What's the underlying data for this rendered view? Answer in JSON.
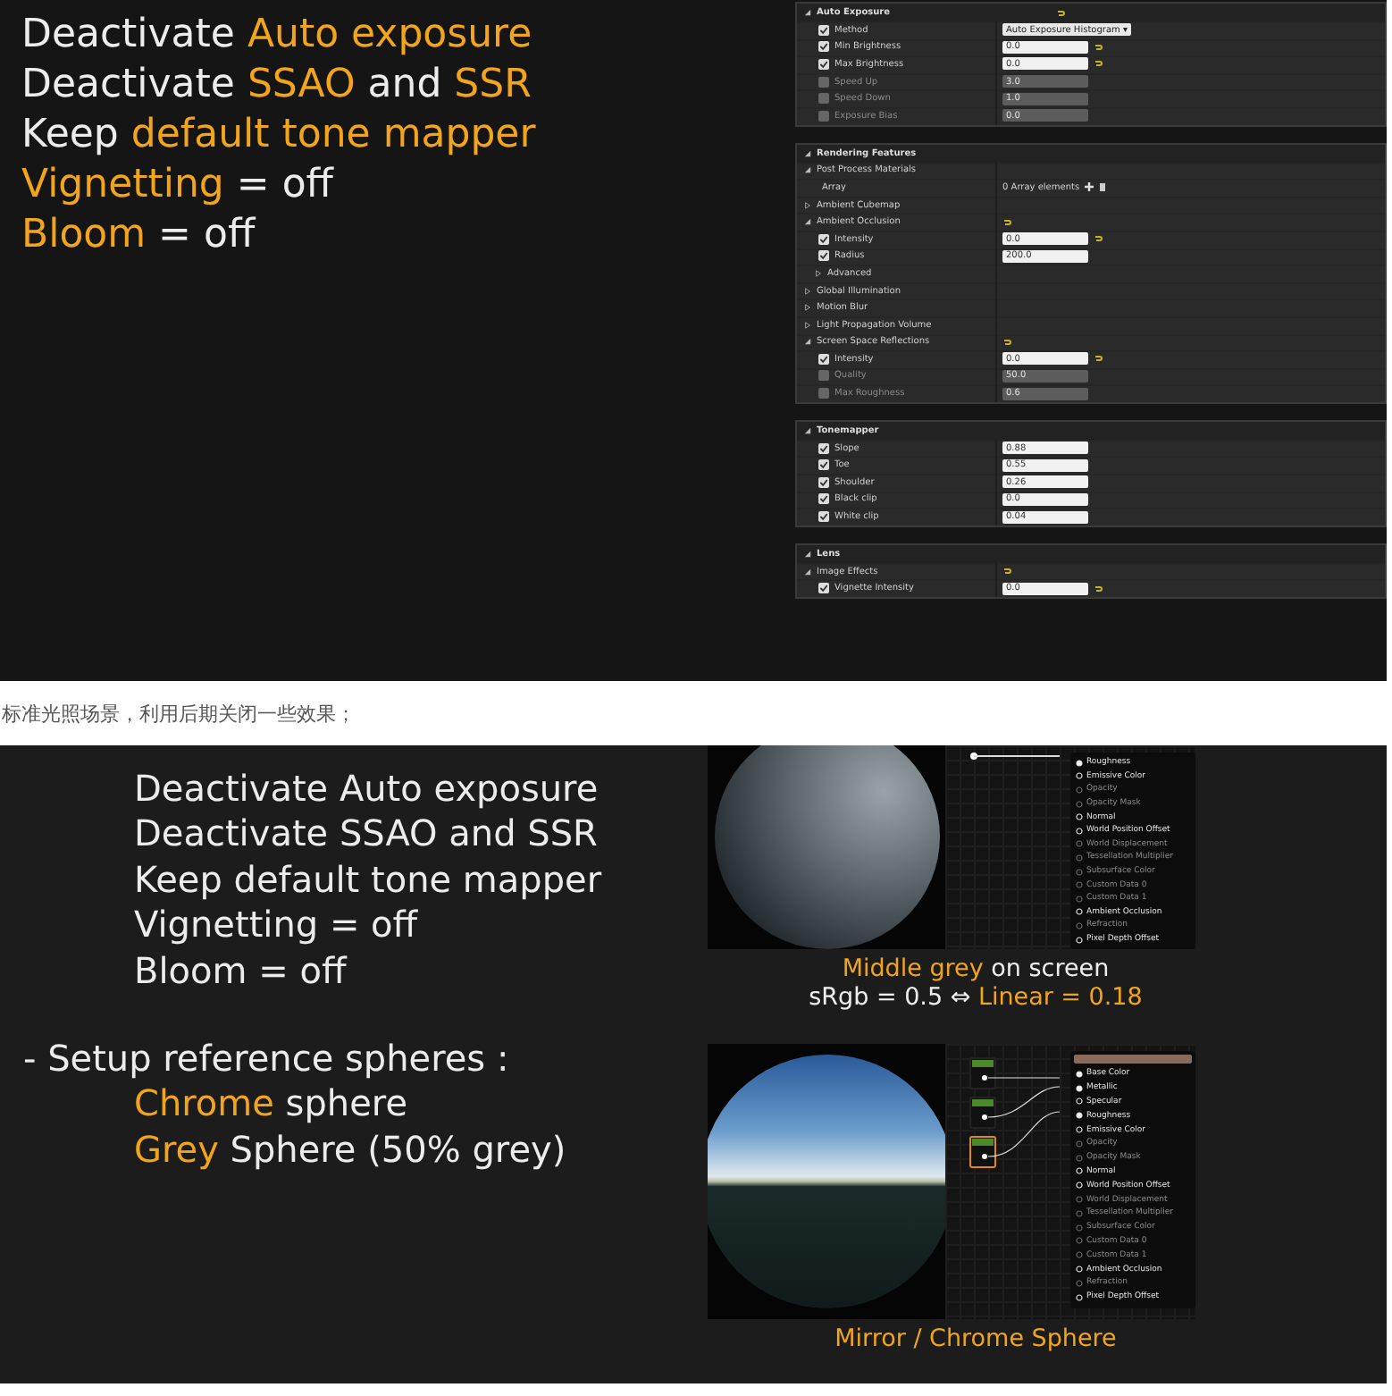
{
  "top_slide": {
    "lines": [
      {
        "segments": [
          {
            "text": "Deactivate ",
            "highlight": false
          },
          {
            "text": "Auto exposure",
            "highlight": true
          }
        ]
      },
      {
        "segments": [
          {
            "text": "Deactivate ",
            "highlight": false
          },
          {
            "text": "SSAO",
            "highlight": true
          },
          {
            "text": " and ",
            "highlight": false
          },
          {
            "text": "SSR",
            "highlight": true
          }
        ]
      },
      {
        "segments": [
          {
            "text": "Keep ",
            "highlight": false
          },
          {
            "text": "default tone mapper",
            "highlight": true
          }
        ]
      },
      {
        "segments": [
          {
            "text": "Vignetting",
            "highlight": true
          },
          {
            "text": " = off",
            "highlight": false
          }
        ]
      },
      {
        "segments": [
          {
            "text": "Bloom",
            "highlight": true
          },
          {
            "text": " = off",
            "highlight": false
          }
        ]
      }
    ],
    "details_panel": {
      "sections": [
        {
          "title": "Auto Exposure",
          "reset": true,
          "rows": [
            {
              "kind": "dropdown",
              "label": "Method",
              "checked": true,
              "disabled": false,
              "value": "Auto Exposure Histogram ▾",
              "reset": false
            },
            {
              "kind": "check",
              "label": "Min Brightness",
              "checked": true,
              "disabled": false,
              "value": "0.0",
              "reset": true
            },
            {
              "kind": "check",
              "label": "Max Brightness",
              "checked": true,
              "disabled": false,
              "value": "0.0",
              "reset": true
            },
            {
              "kind": "check",
              "label": "Speed Up",
              "checked": false,
              "disabled": true,
              "value": "3.0",
              "reset": false
            },
            {
              "kind": "check",
              "label": "Speed Down",
              "checked": false,
              "disabled": true,
              "value": "1.0",
              "reset": false
            },
            {
              "kind": "check",
              "label": "Exposure Bias",
              "checked": false,
              "disabled": true,
              "value": "0.0",
              "reset": false
            }
          ]
        },
        {
          "title": "Rendering Features",
          "reset": false,
          "rows": [
            {
              "kind": "category",
              "label": "Post Process Materials",
              "expanded": true,
              "reset": false
            },
            {
              "kind": "array",
              "label": "Array",
              "value": "0 Array elements"
            },
            {
              "kind": "category",
              "label": "Ambient Cubemap",
              "expanded": false,
              "reset": false
            },
            {
              "kind": "category",
              "label": "Ambient Occlusion",
              "expanded": true,
              "reset": true
            },
            {
              "kind": "check",
              "label": "Intensity",
              "checked": true,
              "disabled": false,
              "value": "0.0",
              "reset": true
            },
            {
              "kind": "check",
              "label": "Radius",
              "checked": true,
              "disabled": false,
              "value": "200.0",
              "reset": false
            },
            {
              "kind": "subcategory",
              "label": "Advanced",
              "expanded": false
            },
            {
              "kind": "category",
              "label": "Global Illumination",
              "expanded": false,
              "reset": false
            },
            {
              "kind": "category",
              "label": "Motion Blur",
              "expanded": false,
              "reset": false
            },
            {
              "kind": "category",
              "label": "Light Propagation Volume",
              "expanded": false,
              "reset": false
            },
            {
              "kind": "category",
              "label": "Screen Space Reflections",
              "expanded": true,
              "reset": true
            },
            {
              "kind": "check",
              "label": "Intensity",
              "checked": true,
              "disabled": false,
              "value": "0.0",
              "reset": true
            },
            {
              "kind": "check",
              "label": "Quality",
              "checked": false,
              "disabled": true,
              "value": "50.0",
              "reset": false
            },
            {
              "kind": "check",
              "label": "Max Roughness",
              "checked": false,
              "disabled": true,
              "value": "0.6",
              "reset": false
            }
          ]
        },
        {
          "title": "Tonemapper",
          "reset": false,
          "rows": [
            {
              "kind": "check",
              "label": "Slope",
              "checked": true,
              "disabled": false,
              "value": "0.88",
              "reset": false
            },
            {
              "kind": "check",
              "label": "Toe",
              "checked": true,
              "disabled": false,
              "value": "0.55",
              "reset": false
            },
            {
              "kind": "check",
              "label": "Shoulder",
              "checked": true,
              "disabled": false,
              "value": "0.26",
              "reset": false
            },
            {
              "kind": "check",
              "label": "Black clip",
              "checked": true,
              "disabled": false,
              "value": "0.0",
              "reset": false
            },
            {
              "kind": "check",
              "label": "White clip",
              "checked": true,
              "disabled": false,
              "value": "0.04",
              "reset": false
            }
          ]
        },
        {
          "title": "Lens",
          "reset": false,
          "rows": [
            {
              "kind": "category",
              "label": "Image Effects",
              "expanded": true,
              "reset": true
            },
            {
              "kind": "check",
              "label": "Vignette Intensity",
              "checked": true,
              "disabled": false,
              "value": "0.0",
              "reset": true
            }
          ]
        }
      ]
    }
  },
  "caption": "标准光照场景，利用后期关闭一些效果；",
  "bottom_slide": {
    "lines": [
      {
        "indent": true,
        "segments": [
          {
            "text": "Deactivate Auto exposure",
            "highlight": false
          }
        ]
      },
      {
        "indent": true,
        "segments": [
          {
            "text": "Deactivate SSAO and SSR",
            "highlight": false
          }
        ]
      },
      {
        "indent": true,
        "segments": [
          {
            "text": "Keep default tone mapper",
            "highlight": false
          }
        ]
      },
      {
        "indent": true,
        "segments": [
          {
            "text": "Vignetting = off",
            "highlight": false
          }
        ]
      },
      {
        "indent": true,
        "segments": [
          {
            "text": "Bloom = off",
            "highlight": false
          }
        ]
      },
      {
        "indent": false,
        "segments": [
          {
            "text": "- Setup reference spheres :",
            "highlight": false
          }
        ]
      },
      {
        "indent": true,
        "segments": [
          {
            "text": "Chrome",
            "highlight": true
          },
          {
            "text": " sphere",
            "highlight": false
          }
        ]
      },
      {
        "indent": true,
        "segments": [
          {
            "text": "Grey",
            "highlight": true
          },
          {
            "text": " Sphere (50% grey)",
            "highlight": false
          }
        ]
      }
    ],
    "renders": [
      {
        "kind": "grey",
        "pins": [
          {
            "label": "Roughness",
            "connected": true
          },
          {
            "label": "Emissive Color",
            "connected": false
          },
          {
            "label": "Opacity",
            "disabled": true
          },
          {
            "label": "Opacity Mask",
            "disabled": true
          },
          {
            "label": "Normal",
            "connected": false
          },
          {
            "label": "World Position Offset",
            "connected": false
          },
          {
            "label": "World Displacement",
            "disabled": true
          },
          {
            "label": "Tessellation Multiplier",
            "disabled": true
          },
          {
            "label": "Subsurface Color",
            "disabled": true
          },
          {
            "label": "Custom Data 0",
            "disabled": true
          },
          {
            "label": "Custom Data 1",
            "disabled": true
          },
          {
            "label": "Ambient Occlusion",
            "connected": false
          },
          {
            "label": "Refraction",
            "disabled": true
          },
          {
            "label": "Pixel Depth Offset",
            "connected": false
          }
        ],
        "caption": [
          [
            {
              "text": "Middle grey",
              "highlight": true
            },
            {
              "text": " on screen",
              "highlight": false
            }
          ],
          [
            {
              "text": "sRgb = 0.5 ⇔ ",
              "highlight": false
            },
            {
              "text": "Linear = 0.18",
              "highlight": true
            }
          ]
        ]
      },
      {
        "kind": "chrome",
        "pins": [
          {
            "label": "Base Color",
            "connected": true
          },
          {
            "label": "Metallic",
            "connected": true
          },
          {
            "label": "Specular",
            "connected": false
          },
          {
            "label": "Roughness",
            "connected": true
          },
          {
            "label": "Emissive Color",
            "connected": false
          },
          {
            "label": "Opacity",
            "disabled": true
          },
          {
            "label": "Opacity Mask",
            "disabled": true
          },
          {
            "label": "Normal",
            "connected": false
          },
          {
            "label": "World Position Offset",
            "connected": false
          },
          {
            "label": "World Displacement",
            "disabled": true
          },
          {
            "label": "Tessellation Multiplier",
            "disabled": true
          },
          {
            "label": "Subsurface Color",
            "disabled": true
          },
          {
            "label": "Custom Data 0",
            "disabled": true
          },
          {
            "label": "Custom Data 1",
            "disabled": true
          },
          {
            "label": "Ambient Occlusion",
            "connected": false
          },
          {
            "label": "Refraction",
            "disabled": true
          },
          {
            "label": "Pixel Depth Offset",
            "connected": false
          }
        ],
        "caption": [
          [
            {
              "text": "Mirror / Chrome Sphere",
              "highlight": true
            }
          ]
        ]
      }
    ]
  }
}
